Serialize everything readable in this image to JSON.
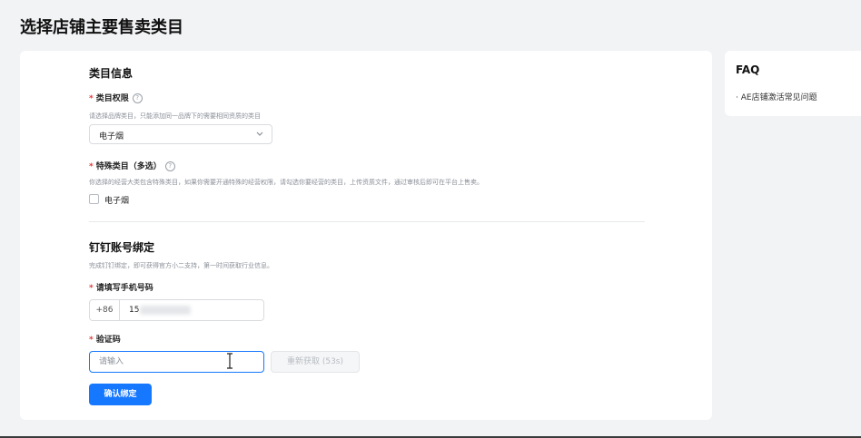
{
  "page": {
    "title": "选择店铺主要售卖类目"
  },
  "category_section": {
    "title": "类目信息",
    "permission": {
      "required_mark": "*",
      "label": "类目权限",
      "help_icon": "question-circle-icon",
      "hint": "请选择品牌类目，只能添加同一品牌下的需要相同资质的类目",
      "selected_value": "电子烟",
      "dropdown_icon": "chevron-down-icon"
    },
    "special": {
      "required_mark": "*",
      "label": "特殊类目（多选）",
      "help_icon": "question-circle-icon",
      "hint": "你选择的经营大类包含特殊类目，如果你需要开通特殊的经营权限，请勾选你要经营的类目，上传资质文件，通过审核后即可在平台上售卖。",
      "checkbox_label": "电子烟",
      "checked": false
    }
  },
  "dingtalk_section": {
    "title": "钉钉账号绑定",
    "hint": "完成钉钉绑定，即可获得官方小二支持，第一时间获取行业信息。",
    "phone": {
      "required_mark": "*",
      "label": "请填写手机号码",
      "prefix": "+86",
      "value": "15"
    },
    "code": {
      "required_mark": "*",
      "label": "验证码",
      "placeholder": "请输入",
      "resend_label": "重新获取 (53s)"
    },
    "confirm_label": "确认绑定"
  },
  "faq": {
    "title": "FAQ",
    "links": [
      "· AE店铺激活常见问题"
    ]
  },
  "colors": {
    "primary": "#1677ff",
    "required": "#e5383b",
    "background": "#f2f3f5"
  }
}
